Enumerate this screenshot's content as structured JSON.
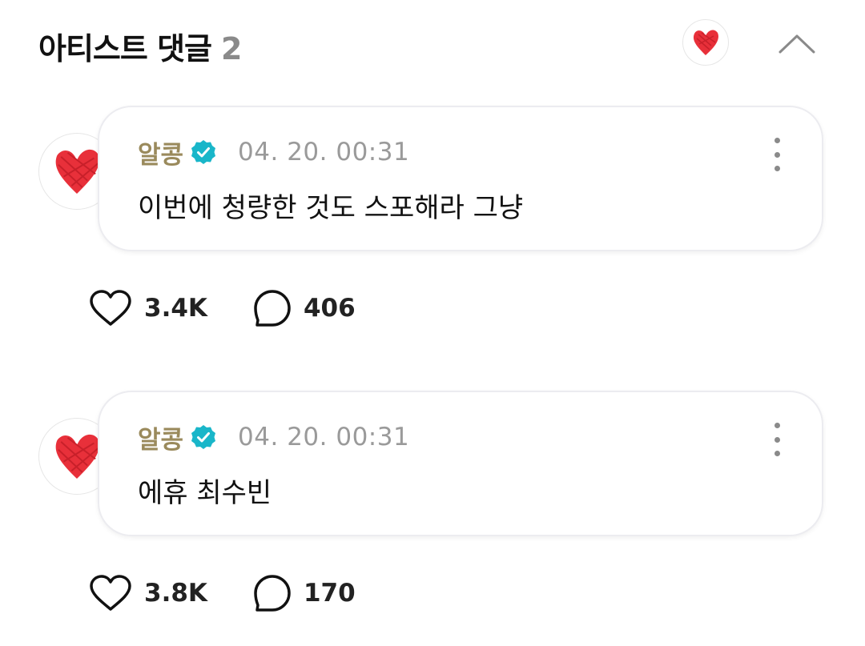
{
  "header": {
    "title": "아티스트 댓글",
    "count": "2"
  },
  "icons": {
    "artist_avatar": "red-heart-icon",
    "collapse": "chevron-up-icon",
    "verified": "verified-badge-icon",
    "more": "more-vertical-icon",
    "like": "heart-outline-icon",
    "reply": "speech-bubble-icon"
  },
  "colors": {
    "heart": "#e8303a",
    "verified": "#19b6c9",
    "author": "#9a8a5c",
    "timestamp": "#9a9a9a"
  },
  "comments": [
    {
      "author": "알콩",
      "timestamp": "04. 20. 00:31",
      "text": "이번에 청량한 것도 스포해라 그냥",
      "likes": "3.4K",
      "replies": "406"
    },
    {
      "author": "알콩",
      "timestamp": "04. 20. 00:31",
      "text": "에휴 최수빈",
      "likes": "3.8K",
      "replies": "170"
    }
  ]
}
